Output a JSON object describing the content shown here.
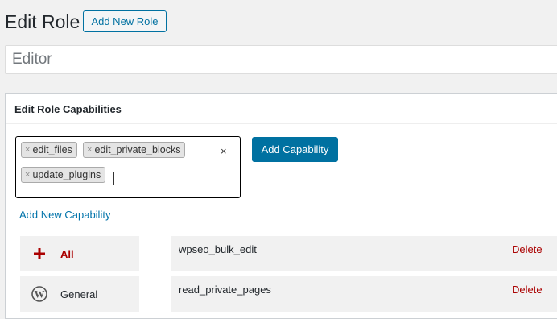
{
  "header": {
    "title": "Edit Role",
    "add_new_role_label": "Add New Role"
  },
  "role_name": {
    "value": "Editor"
  },
  "capabilities_panel": {
    "title": "Edit Role Capabilities",
    "tags": [
      "edit_files",
      "edit_private_blocks",
      "update_plugins"
    ],
    "tag_remove_glyph": "×",
    "clear_all_glyph": "×",
    "add_capability_label": "Add Capability",
    "add_new_capability_link": "Add New Capability",
    "groups": [
      {
        "label": "All",
        "icon": "plus-icon",
        "color": "#a00"
      },
      {
        "label": "General",
        "icon": "wordpress-icon",
        "color": "#23282d"
      }
    ],
    "capabilities": [
      {
        "name": "wpseo_bulk_edit",
        "delete_label": "Delete"
      },
      {
        "name": "read_private_pages",
        "delete_label": "Delete"
      }
    ]
  },
  "colors": {
    "accent": "#0071a1",
    "delete": "#aa0000",
    "background": "#f1f1f1"
  }
}
